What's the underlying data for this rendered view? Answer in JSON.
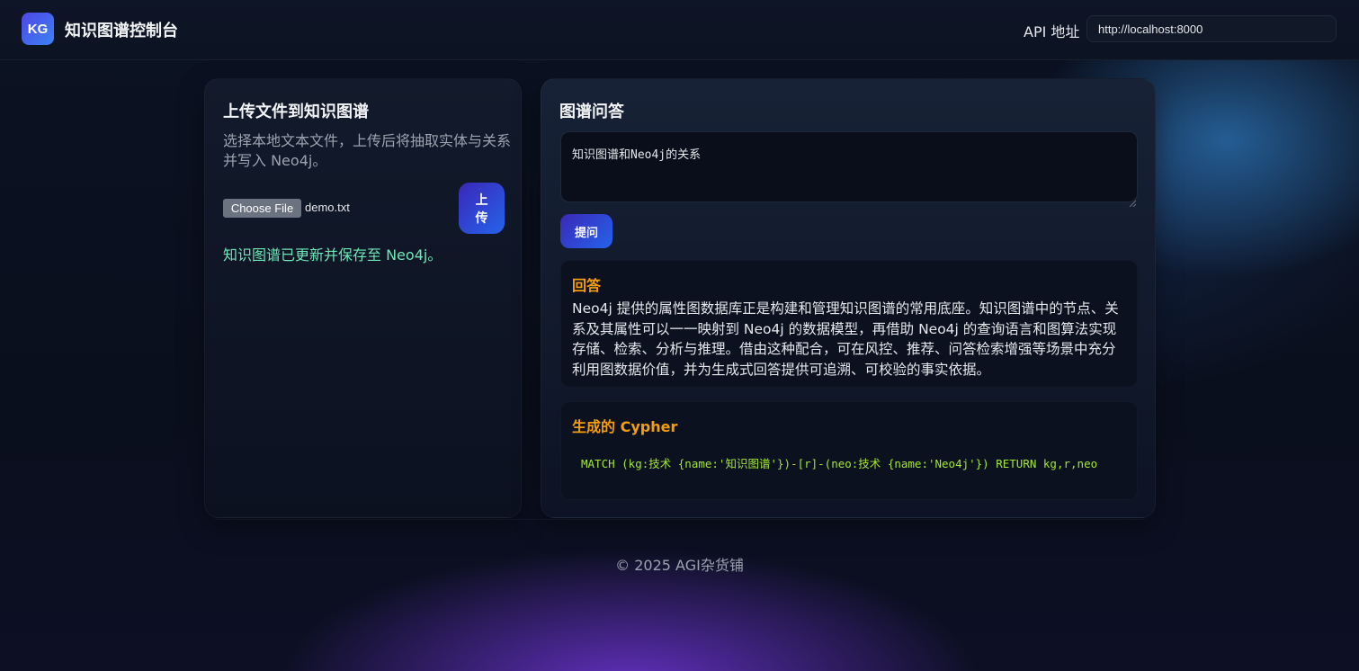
{
  "header": {
    "logo_text": "KG",
    "title": "知识图谱控制台",
    "api_label": "API 地址",
    "api_url": "http://localhost:8000"
  },
  "upload": {
    "title": "上传文件到知识图谱",
    "description": "选择本地文本文件，上传后将抽取实体与关系并写入 Neo4j。",
    "choose_file_label": "Choose File",
    "file_name": "demo.txt",
    "upload_button_label": "上传",
    "status_message": "知识图谱已更新并保存至 Neo4j。"
  },
  "qa": {
    "title": "图谱问答",
    "question": "知识图谱和Neo4j的关系",
    "ask_button_label": "提问",
    "answer_title": "回答",
    "answer_text": "Neo4j 提供的属性图数据库正是构建和管理知识图谱的常用底座。知识图谱中的节点、关系及其属性可以一一映射到 Neo4j 的数据模型，再借助 Neo4j 的查询语言和图算法实现存储、检索、分析与推理。借由这种配合，可在风控、推荐、问答检索增强等场景中充分利用图数据价值，并为生成式回答提供可追溯、可校验的事实依据。",
    "cypher_title": "生成的 Cypher",
    "cypher_code": "MATCH (kg:技术 {name:'知识图谱'})-[r]-(neo:技术 {name:'Neo4j'}) RETURN kg,r,neo"
  },
  "footer": {
    "text": "© 2025 AGI杂货铺"
  },
  "colors": {
    "accent_gradient_start": "#3b27b8",
    "accent_gradient_end": "#2563eb",
    "success": "#6ee7b7",
    "heading_orange": "#f59e0b",
    "code_green": "#a3e635"
  }
}
